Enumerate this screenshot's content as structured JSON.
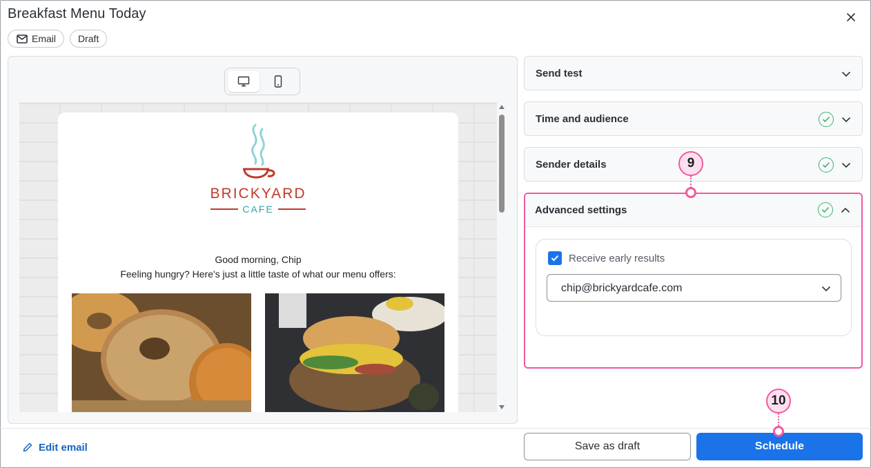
{
  "window": {
    "title": "Breakfast Menu Today"
  },
  "chips": {
    "email_label": "Email",
    "draft_label": "Draft"
  },
  "preview": {
    "devices": [
      {
        "name": "desktop",
        "icon": "desktop-icon",
        "active": true
      },
      {
        "name": "mobile",
        "icon": "mobile-icon",
        "active": false
      }
    ],
    "logo": {
      "name": "BRICKYARD",
      "sub": "CAFE",
      "colors": {
        "primary": "#c0392b",
        "accent": "#2aa5b3",
        "steam": "#8fd3d6"
      }
    },
    "greeting_line1": "Good morning, Chip",
    "greeting_line2": "Feeling hungry? Here's just a little taste of what our menu offers:"
  },
  "panels": {
    "send_test": {
      "title": "Send test",
      "complete": false
    },
    "time_audience": {
      "title": "Time and audience",
      "complete": true
    },
    "sender_details": {
      "title": "Sender details",
      "complete": true
    },
    "advanced": {
      "title": "Advanced settings",
      "complete": true,
      "expanded": true,
      "checkbox_label": "Receive early results",
      "checkbox_checked": true,
      "email_select_value": "chip@brickyardcafe.com"
    }
  },
  "callouts": {
    "first": "9",
    "second": "10"
  },
  "footer": {
    "edit_email_label": "Edit email",
    "save_draft_label": "Save as draft",
    "schedule_label": "Schedule"
  },
  "colors": {
    "primary_blue": "#1a73e8",
    "link_blue": "#1565c0",
    "success_green": "#3bb36f",
    "callout_pink": "#ee5a9f"
  }
}
